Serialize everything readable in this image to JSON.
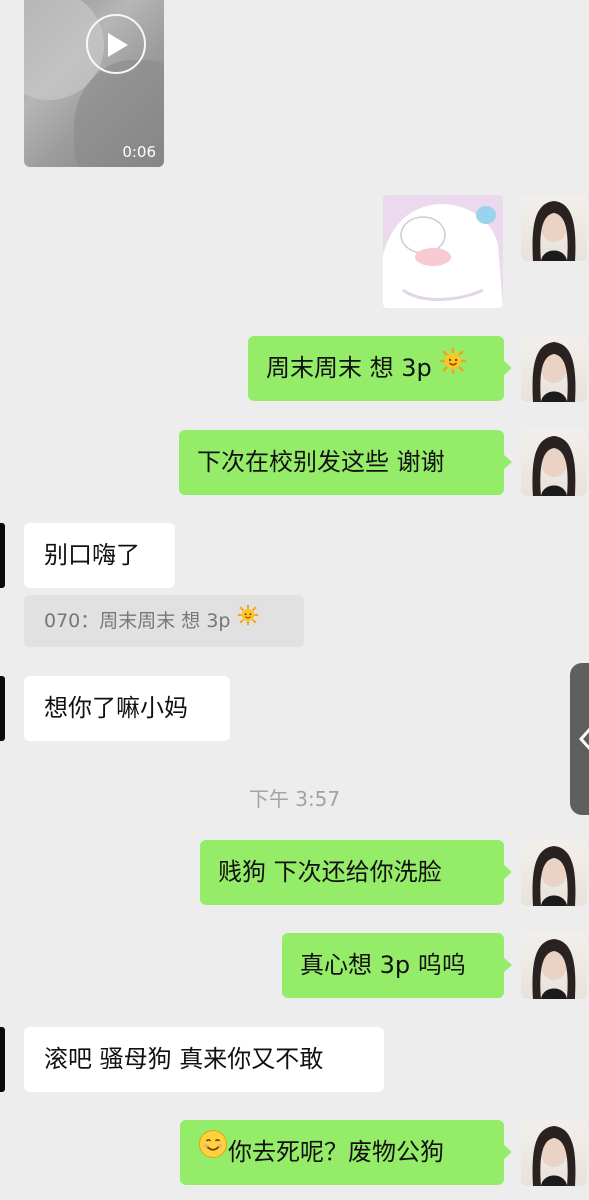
{
  "video": {
    "duration": "0:06",
    "icon": "play-icon"
  },
  "messages": {
    "m1": "周末周末 想 3p",
    "m2": "下次在校别发这些 谢谢",
    "m3": "别口嗨了",
    "quote": "070：周末周末 想 3p",
    "m4": "想你了嘛小妈",
    "time": "下午 3:57",
    "m5": "贱狗 下次还给你洗脸",
    "m6": "真心想 3p 呜呜",
    "m7": "滚吧 骚母狗 真来你又不敢",
    "m8": "你去死呢？废物公狗"
  },
  "icons": {
    "sun": "sun-emoji",
    "smile": "smiling-face-emoji"
  },
  "colors": {
    "background": "#ededed",
    "outgoing_bubble": "#95ec69",
    "incoming_bubble": "#ffffff"
  }
}
